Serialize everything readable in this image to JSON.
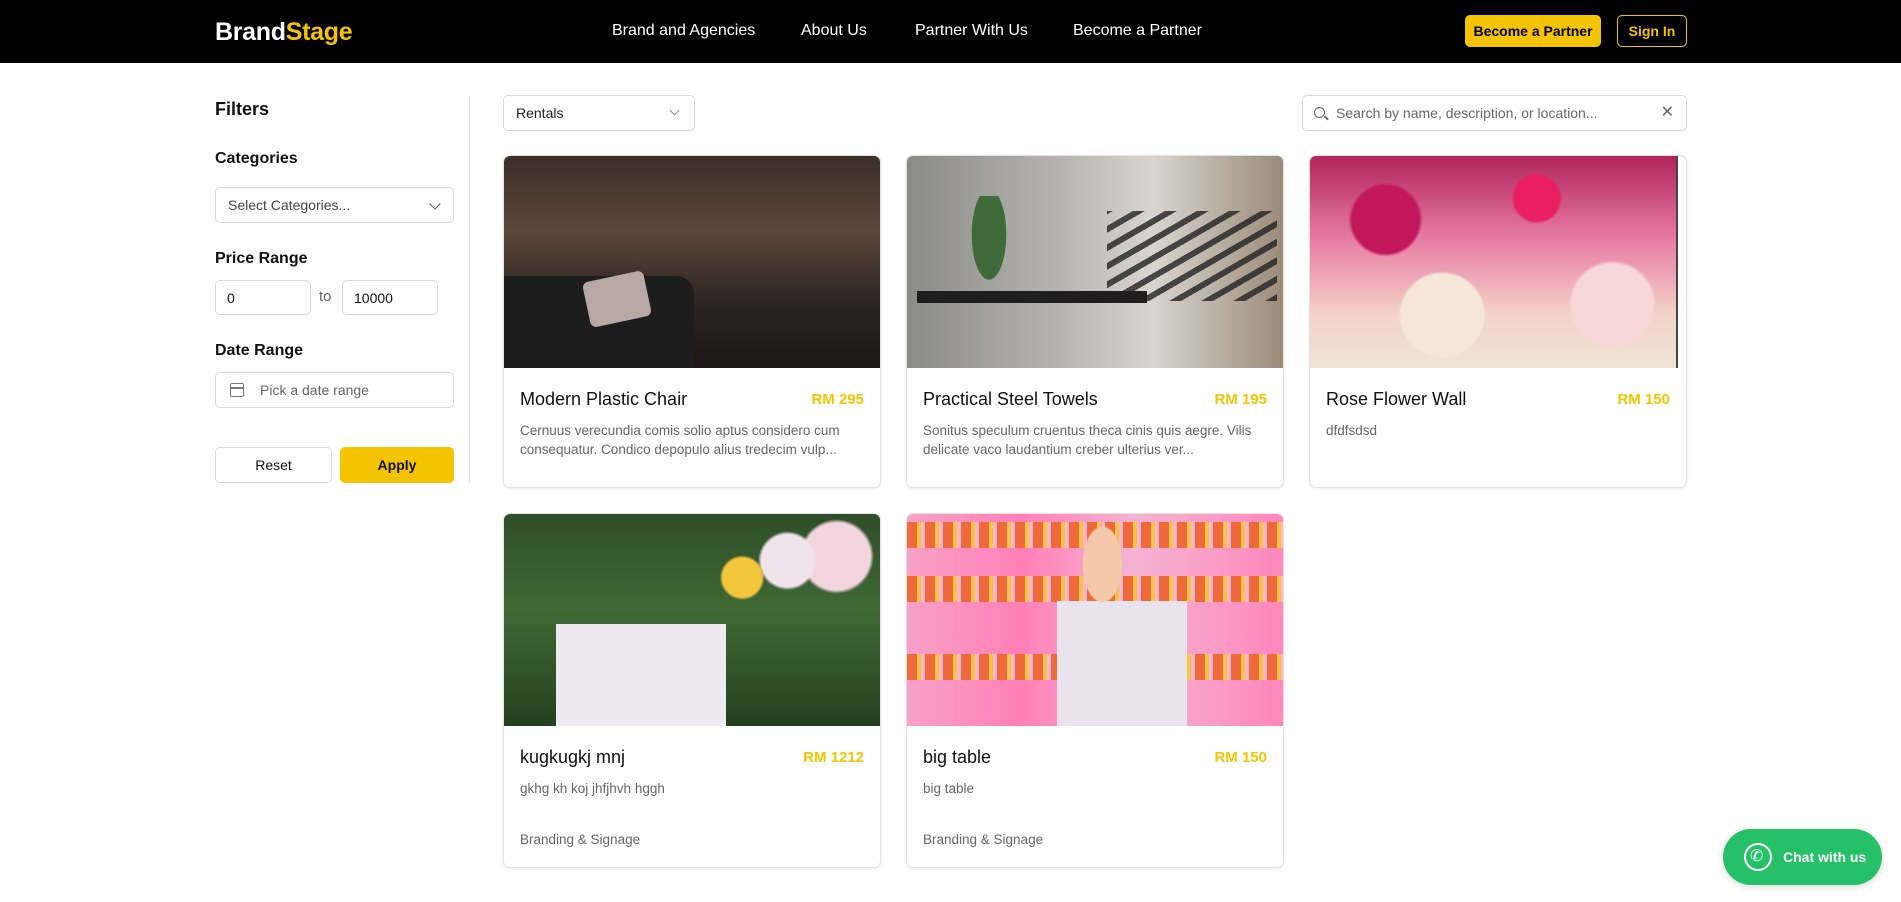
{
  "brand": {
    "part1": "Brand",
    "part2": "Stage"
  },
  "nav": {
    "links": [
      "Brand and Agencies",
      "About Us",
      "Partner With Us",
      "Become a Partner"
    ],
    "cta_partner": "Become a Partner",
    "cta_signin": "Sign In"
  },
  "filters": {
    "heading": "Filters",
    "categories_label": "Categories",
    "categories_placeholder": "Select Categories...",
    "price_label": "Price Range",
    "price_min": "0",
    "price_to": "to",
    "price_max": "10000",
    "date_label": "Date Range",
    "date_placeholder": "Pick a date range",
    "reset": "Reset",
    "apply": "Apply"
  },
  "toolbar": {
    "type_selected": "Rentals",
    "search_placeholder": "Search by name, description, or location..."
  },
  "cards": [
    {
      "title": "Modern Plastic Chair",
      "price": "RM 295",
      "desc": "Cernuus verecundia comis solio aptus considero cum consequatur. Condico depopulo alius tredecim vulp...",
      "category": ""
    },
    {
      "title": "Practical Steel Towels",
      "price": "RM 195",
      "desc": "Sonitus speculum cruentus theca cinis quis aegre. Vilis delicate vaco laudantium creber ulterius ver...",
      "category": ""
    },
    {
      "title": "Rose Flower Wall",
      "price": "RM 150",
      "desc": "dfdfsdsd",
      "category": ""
    },
    {
      "title": "kugkugkj mnj",
      "price": "RM 1212",
      "desc": "gkhg kh koj jhfjhvh hggh",
      "category": "Branding & Signage"
    },
    {
      "title": "big table",
      "price": "RM 150",
      "desc": "big table",
      "category": "Branding & Signage"
    }
  ],
  "chat": {
    "label": "Chat with us"
  },
  "colors": {
    "accent": "#f5c400",
    "nav_bg": "#000000",
    "chat": "#25c067"
  },
  "icons": [
    "chevron-down-icon",
    "calendar-icon",
    "search-icon",
    "close-icon",
    "whatsapp-icon"
  ]
}
